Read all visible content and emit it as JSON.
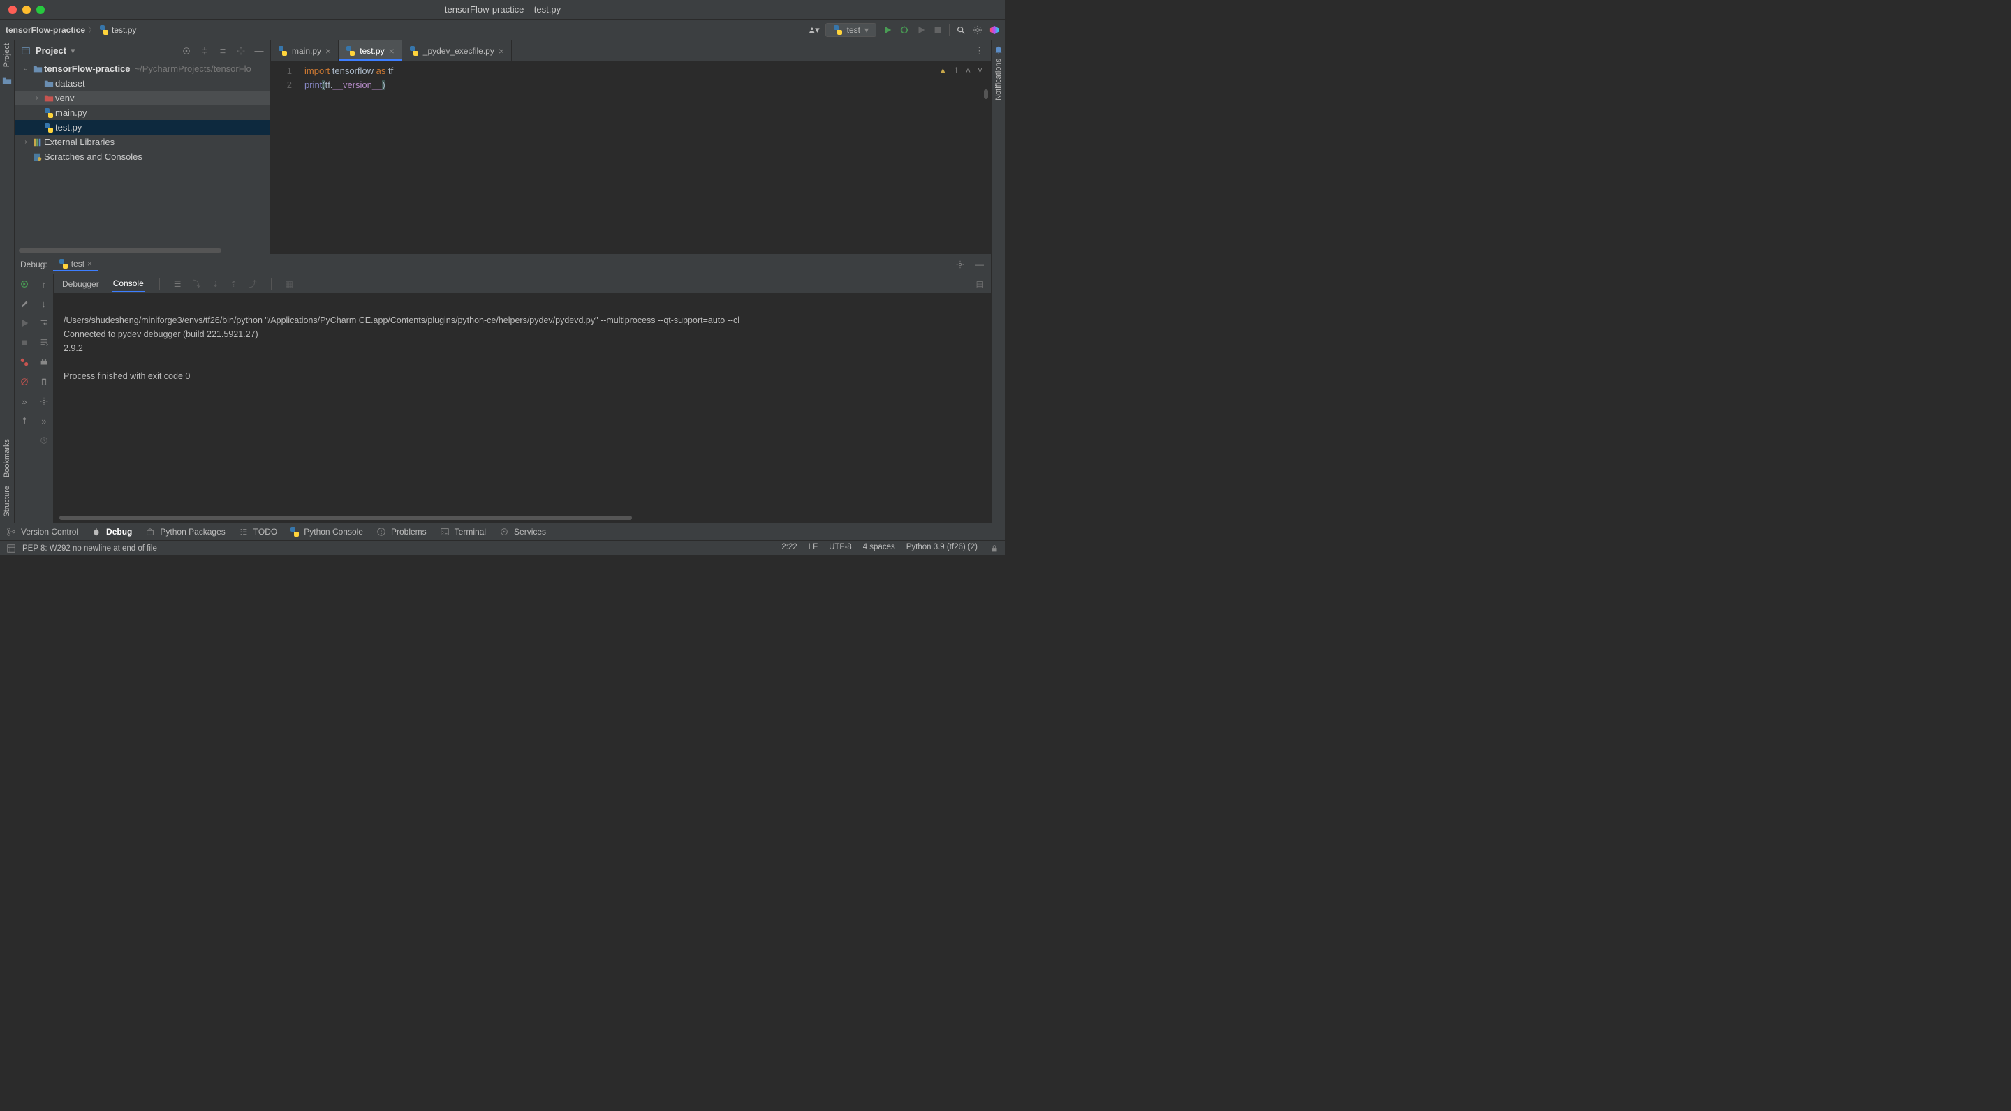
{
  "window": {
    "title": "tensorFlow-practice – test.py"
  },
  "breadcrumb": {
    "project": "tensorFlow-practice",
    "file": "test.py"
  },
  "run_config": {
    "name": "test"
  },
  "project_panel": {
    "title": "Project",
    "tree": {
      "root_name": "tensorFlow-practice",
      "root_path": "~/PycharmProjects/tensorFlo",
      "items": [
        "dataset",
        "venv",
        "main.py",
        "test.py"
      ],
      "external": "External Libraries",
      "scratches": "Scratches and Consoles"
    }
  },
  "editor": {
    "tabs": [
      {
        "label": "main.py"
      },
      {
        "label": "test.py"
      },
      {
        "label": "_pydev_execfile.py"
      }
    ],
    "warning_count": "1",
    "code": {
      "line1": {
        "kw1": "import",
        "mod": "tensorflow",
        "kw2": "as",
        "alias": "tf"
      },
      "line2": {
        "fn": "print",
        "obj": "tf",
        "attr": "__version__"
      }
    },
    "gutter": [
      "1",
      "2"
    ]
  },
  "debug": {
    "label": "Debug:",
    "run_name": "test",
    "tabs": {
      "debugger": "Debugger",
      "console": "Console"
    },
    "console_lines": [
      "/Users/shudesheng/miniforge3/envs/tf26/bin/python \"/Applications/PyCharm CE.app/Contents/plugins/python-ce/helpers/pydev/pydevd.py\" --multiprocess --qt-support=auto --cl",
      "Connected to pydev debugger (build 221.5921.27)",
      "2.9.2",
      "",
      "Process finished with exit code 0"
    ]
  },
  "leftgutter": {
    "project": "Project",
    "bookmarks": "Bookmarks",
    "structure": "Structure"
  },
  "rightgutter": {
    "notifications": "Notifications"
  },
  "bottombar": {
    "version_control": "Version Control",
    "debug": "Debug",
    "python_packages": "Python Packages",
    "todo": "TODO",
    "python_console": "Python Console",
    "problems": "Problems",
    "terminal": "Terminal",
    "services": "Services"
  },
  "statusbar": {
    "message": "PEP 8: W292 no newline at end of file",
    "pos": "2:22",
    "line_sep": "LF",
    "encoding": "UTF-8",
    "indent": "4 spaces",
    "interpreter": "Python 3.9 (tf26) (2)"
  }
}
